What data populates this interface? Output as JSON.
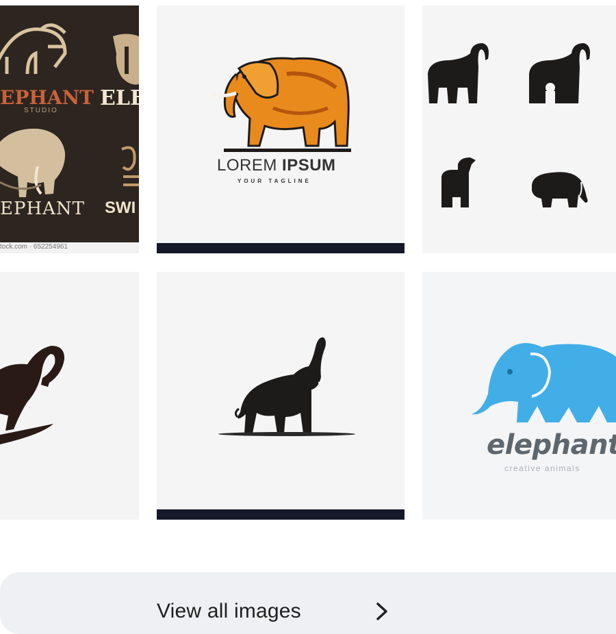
{
  "results": {
    "tiles": [
      {
        "id": "vintage-elephant-badges",
        "texts": [
          "EPHANT",
          "STUDIO",
          "ELE",
          "EPHANT",
          "SWI"
        ],
        "caption": "tock.com · 652254961"
      },
      {
        "id": "orange-elephant-logo",
        "brand": "LOREM",
        "brand_bold": "IPSUM",
        "tagline": "YOUR TAGLINE"
      },
      {
        "id": "four-elephant-icons"
      },
      {
        "id": "trunk-raised-brown-elephant"
      },
      {
        "id": "walking-elephant-silhouette"
      },
      {
        "id": "blue-elephant-logo",
        "brand": "elephant",
        "tagline": "creative animals"
      }
    ]
  },
  "view_all": {
    "label": "View all images"
  },
  "colors": {
    "orange_elephant": "#e98a1c",
    "blue_elephant": "#41aee8",
    "dark_silhouette": "#1d1a1a",
    "vintage_bg": "#2c2520",
    "vintage_ink": "#d9c3a0"
  },
  "icons": [
    "chevron-right-icon"
  ]
}
